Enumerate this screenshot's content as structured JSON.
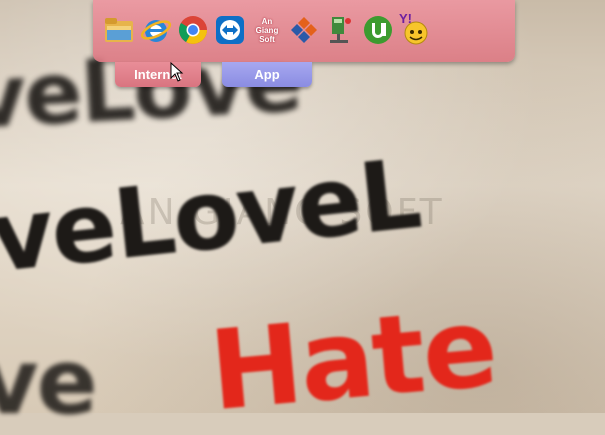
{
  "wallpaper": {
    "rows": [
      "veLove",
      "veLoveL",
      "Hate",
      "ve"
    ],
    "watermark": "AN GIANG SOFT"
  },
  "dock": {
    "icons": [
      {
        "name": "folder-icon"
      },
      {
        "name": "internet-explorer-icon"
      },
      {
        "name": "chrome-icon"
      },
      {
        "name": "teamviewer-icon"
      },
      {
        "name": "angiangsoft-icon",
        "lines": [
          "An",
          "Giang",
          "Soft"
        ]
      },
      {
        "name": "app-cross-icon"
      },
      {
        "name": "network-icon"
      },
      {
        "name": "utorrent-icon"
      },
      {
        "name": "yahoo-messenger-icon",
        "label": "Y!"
      }
    ],
    "tabs": [
      {
        "label": "Internet"
      },
      {
        "label": "App"
      }
    ]
  },
  "colors": {
    "dock": "#e8939c",
    "internet_tab": "#e17f8a",
    "app_tab": "#9a9be9",
    "hate_red": "#e3271b"
  }
}
